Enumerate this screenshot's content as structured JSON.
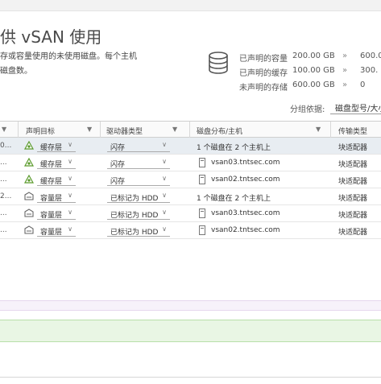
{
  "header": {
    "title": "供 vSAN 使用",
    "description_line1": "存或容量使用的未使用磁盘。每个主机",
    "description_line2": "磁盘数。"
  },
  "stats": [
    {
      "label": "已声明的容量",
      "value": "200.00 GB",
      "sep": "»",
      "compare": "600.0"
    },
    {
      "label": "已声明的缓存",
      "value": "100.00 GB",
      "sep": "»",
      "compare": "300."
    },
    {
      "label": "未声明的存储",
      "value": "600.00 GB",
      "sep": "»",
      "compare": "0"
    }
  ],
  "grouping": {
    "label": "分组依据:",
    "value": "磁盘型号/大小"
  },
  "table": {
    "headers": {
      "claim_target": "声明目标",
      "drive_type": "驱动器类型",
      "disk_distribution": "磁盘分布/主机",
      "transport_type": "传输类型"
    },
    "rows": [
      {
        "col0": "0...",
        "claim": "缓存层",
        "drive": "闪存",
        "distribution": "1 个磁盘在 2 个主机上",
        "transport": "块适配器",
        "is_group": true,
        "selected": true,
        "tier": "cache"
      },
      {
        "col0": "...",
        "claim": "缓存层",
        "drive": "闪存",
        "distribution": "vsan03.tntsec.com",
        "transport": "块适配器",
        "is_group": false,
        "selected": false,
        "tier": "cache"
      },
      {
        "col0": "...",
        "claim": "缓存层",
        "drive": "闪存",
        "distribution": "vsan02.tntsec.com",
        "transport": "块适配器",
        "is_group": false,
        "selected": false,
        "tier": "cache"
      },
      {
        "col0": "2...",
        "claim": "容量层",
        "drive": "已标记为 HDD",
        "distribution": "1 个磁盘在 2 个主机上",
        "transport": "块适配器",
        "is_group": true,
        "selected": false,
        "tier": "capacity"
      },
      {
        "col0": "...",
        "claim": "容量层",
        "drive": "已标记为 HDD",
        "distribution": "vsan03.tntsec.com",
        "transport": "块适配器",
        "is_group": false,
        "selected": false,
        "tier": "capacity"
      },
      {
        "col0": "...",
        "claim": "容量层",
        "drive": "已标记为 HDD",
        "distribution": "vsan02.tntsec.com",
        "transport": "块适配器",
        "is_group": false,
        "selected": false,
        "tier": "capacity"
      }
    ]
  },
  "icons": {
    "database": "database-icon",
    "cache_tier": "cache-tier-icon",
    "capacity_tier": "capacity-tier-icon",
    "host": "host-icon",
    "filter": "filter-icon",
    "dropdown": "chevron-down-icon"
  },
  "colors": {
    "selected_row": "#e8edf2",
    "green_band": "#e9f6e4",
    "pink_band": "#f7f2fa"
  }
}
